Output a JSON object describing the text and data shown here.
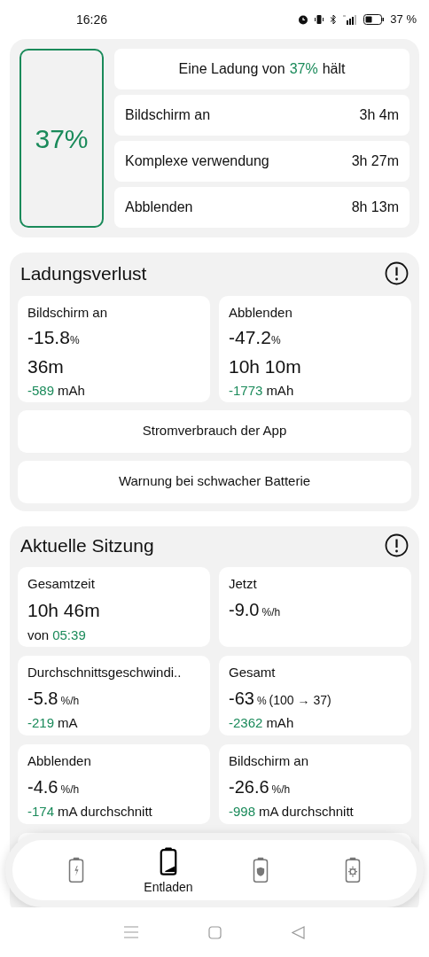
{
  "status_bar": {
    "time": "16:26",
    "battery_text": "37 %"
  },
  "summary": {
    "percent": "37%",
    "headline": {
      "prefix": "Eine Ladung von",
      "value": "37%",
      "suffix": "hält"
    },
    "rows": [
      {
        "label": "Bildschirm an",
        "value": "3h 4m"
      },
      {
        "label": "Komplexe verwendung",
        "value": "3h 27m"
      },
      {
        "label": "Abblenden",
        "value": "8h 13m"
      }
    ]
  },
  "charge_loss": {
    "title": "Ladungsverlust",
    "cards": [
      {
        "label": "Bildschirm an",
        "value": "-15.8",
        "unit": "%",
        "duration": "36m",
        "sub_value": "-589",
        "sub_unit": "mAh"
      },
      {
        "label": "Abblenden",
        "value": "-47.2",
        "unit": "%",
        "duration": "10h 10m",
        "sub_value": "-1773",
        "sub_unit": "mAh"
      }
    ],
    "buttons": [
      "Stromverbrauch der App",
      "Warnung bei schwacher Batterie"
    ]
  },
  "session": {
    "title": "Aktuelle Sitzung",
    "cards": [
      {
        "kind": "time",
        "label": "Gesamtzeit",
        "value": "10h 46m",
        "sub_prefix": "von",
        "sub_value": "05:39"
      },
      {
        "kind": "rate",
        "label": "Jetzt",
        "value": "-9.0",
        "unit": "%/h"
      },
      {
        "kind": "rate",
        "label": "Durchschnittsgeschwindi..",
        "value": "-5.8",
        "unit": "%/h",
        "sub_value": "-219",
        "sub_unit": "mA"
      },
      {
        "kind": "rate",
        "label": "Gesamt",
        "value": "-63",
        "unit": "%",
        "extra": "(100 → 37)",
        "sub_value": "-2362",
        "sub_unit": "mAh"
      },
      {
        "kind": "rate",
        "label": "Abblenden",
        "value": "-4.6",
        "unit": "%/h",
        "sub_value": "-174",
        "sub_unit": "mA durchschnitt"
      },
      {
        "kind": "rate",
        "label": "Bildschirm an",
        "value": "-26.6",
        "unit": "%/h",
        "sub_value": "-998",
        "sub_unit": "mA durchschnitt"
      }
    ]
  },
  "bottom_nav": [
    {
      "kind": "charging",
      "selected": false
    },
    {
      "kind": "discharging",
      "selected": true,
      "label": "Entladen"
    },
    {
      "kind": "health",
      "selected": false
    },
    {
      "kind": "settings",
      "selected": false
    }
  ]
}
